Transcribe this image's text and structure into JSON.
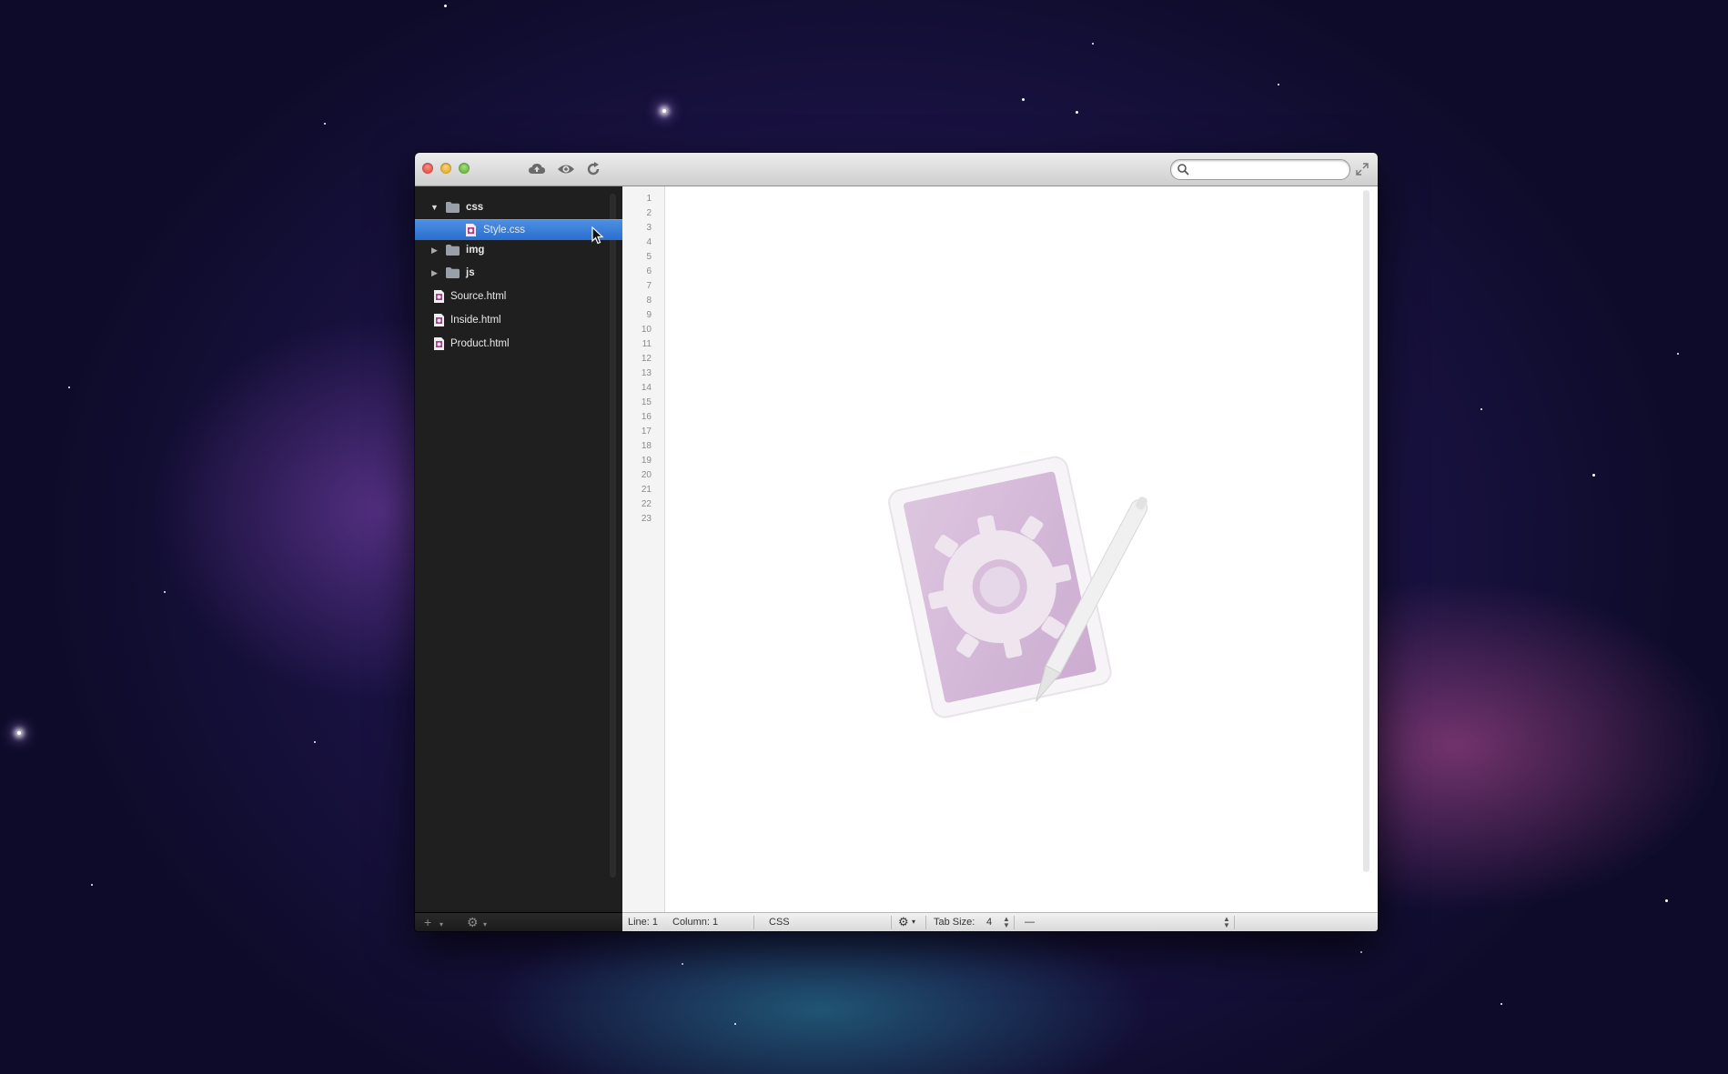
{
  "window": {
    "search_placeholder": ""
  },
  "toolbar": {
    "icons": [
      "cloud-upload-icon",
      "eye-icon",
      "refresh-icon"
    ]
  },
  "sidebar": {
    "tree": [
      {
        "label": "css",
        "kind": "folder",
        "expanded": true
      },
      {
        "label": "Style.css",
        "kind": "file",
        "selected": true
      },
      {
        "label": "img",
        "kind": "folder",
        "expanded": false
      },
      {
        "label": "js",
        "kind": "folder",
        "expanded": false
      },
      {
        "label": "Source.html",
        "kind": "file"
      },
      {
        "label": "Inside.html",
        "kind": "file"
      },
      {
        "label": "Product.html",
        "kind": "file"
      }
    ],
    "footer": {
      "add": "+",
      "gear": "⚙"
    }
  },
  "editor": {
    "line_numbers": [
      "1",
      "2",
      "3",
      "4",
      "5",
      "6",
      "7",
      "8",
      "9",
      "10",
      "11",
      "12",
      "13",
      "14",
      "15",
      "16",
      "17",
      "18",
      "19",
      "20",
      "21",
      "22",
      "23"
    ]
  },
  "statusbar": {
    "line": "Line: 1",
    "column": "Column: 1",
    "syntax": "CSS",
    "tab_size_label": "Tab Size:",
    "tab_size_value": "4",
    "encoding": "—"
  },
  "colors": {
    "selection": "#3b80dd",
    "sidebar_bg": "#1f1f1f",
    "editor_bg": "#ffffff"
  }
}
